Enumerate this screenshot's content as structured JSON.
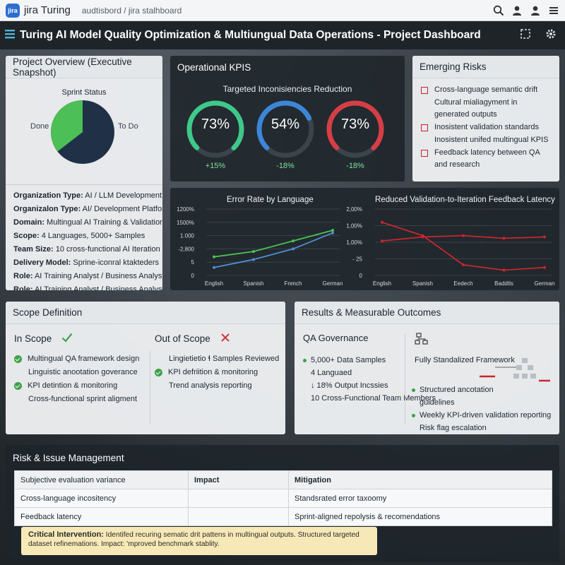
{
  "jira": {
    "logo_text": "jira",
    "app_name": "jira  Turing",
    "breadcrumb": "audtisbord / jira stalhboard"
  },
  "header": {
    "title": "Turing AI Model Quality Optimization & Multiungual Data Operations - Project Dashboard"
  },
  "overview": {
    "heading": "Project Overview (Executive Snapshot)",
    "sprint_status": "Sprint Status",
    "pie": {
      "done_label": "Done",
      "todo_label": "To Do",
      "done_color": "#4cbf56",
      "todo_color": "#1f3047"
    },
    "rows": [
      {
        "key": "Organization Type:",
        "value": " AI / LLM Development"
      },
      {
        "key": "Organizalon Type:",
        "value": " AI/ Development Platform"
      },
      {
        "key": "Domain:",
        "value": " Multingual AI Training & Validation"
      },
      {
        "key": "Scope:",
        "value": " 4 Languages, 5000+ Samples"
      },
      {
        "key": "Team Size:",
        "value": " 10 cross-functional AI Iteration"
      },
      {
        "key": "Delivery Model:",
        "value": " Sprine-iconral ktakteders"
      },
      {
        "key": "Role:",
        "value": " AI Training Analyst / Business Analyst"
      },
      {
        "key": "Role:",
        "value": " AI Training Analyst / Business Analyst"
      }
    ]
  },
  "kpi": {
    "heading": "Operational KPIS",
    "subtitle": "Targeted Inconisiencies Reduction",
    "gauges": [
      {
        "value": "73%",
        "delta": "+15%",
        "fraction": 0.73,
        "color": "#3ec98a"
      },
      {
        "value": "54%",
        "delta": "-18%",
        "fraction": 0.54,
        "color": "#3c86d8"
      },
      {
        "value": "73%",
        "delta": "-18%",
        "fraction": 0.73,
        "color": "#d63e45"
      }
    ]
  },
  "risks": {
    "heading": "Emerging Risks",
    "items": [
      {
        "text": "Cross-language semantic drift",
        "box": true
      },
      {
        "text": "Cultural mialiagyment in generated outputs",
        "box": false
      },
      {
        "text": "Inosistent validation standards",
        "box": true
      },
      {
        "text": "Inosistent unifed multingual KPIS",
        "box": false
      },
      {
        "text": "Feedback latency between QA and research",
        "box": true
      }
    ]
  },
  "chart_data": [
    {
      "type": "line",
      "title": "Error Rate by Language",
      "categories": [
        "English",
        "Spanish",
        "French",
        "German"
      ],
      "y_ticks": [
        "1200%",
        "1500%",
        "1.000",
        "-2,800",
        "5",
        "0"
      ],
      "series": [
        {
          "values": [
            0.7,
            0.9,
            1.3,
            1.7
          ],
          "color": "#4cc352"
        },
        {
          "values": [
            0.3,
            0.6,
            1.0,
            1.6
          ],
          "color": "#4f8fd1"
        }
      ],
      "ylim": [
        0,
        2.5
      ]
    },
    {
      "type": "line",
      "title": "Reduced Validation-to-Iteration Feedback Latency",
      "categories": [
        "English",
        "Spanish",
        "Eedech",
        "Baddtls",
        "German"
      ],
      "y_ticks": [
        "2,00%",
        "1,00%",
        "1,00%",
        "- 25",
        "0"
      ],
      "series": [
        {
          "values": [
            2.0,
            1.5,
            0.4,
            0.2,
            0.3
          ],
          "color": "#c8272e"
        },
        {
          "values": [
            1.3,
            1.45,
            1.5,
            1.4,
            1.45
          ],
          "color": "#c8272e"
        }
      ],
      "ylim": [
        0,
        2.5
      ]
    }
  ],
  "scope": {
    "heading": "Scope Definition",
    "in_title": "In Scope",
    "out_title": "Out of Scope",
    "in_items": [
      {
        "text": "Multingual QA framework design",
        "check": true
      },
      {
        "text": "Linguistic anootation goverance",
        "check": false
      },
      {
        "text": "KPI detintion & monitoring",
        "check": true
      },
      {
        "text": "Cross-functional sprint aligment",
        "check": false
      }
    ],
    "out_items": [
      {
        "text": "Lingietietio ɬ Samples Reviewed",
        "check": false
      },
      {
        "text": "KPI defriition & monitoring",
        "check": true
      },
      {
        "text": "Trend analysis reporting",
        "check": false
      }
    ]
  },
  "results": {
    "heading": "Results & Measurable Outcomes",
    "qa_title": "QA Governance",
    "left_items": [
      {
        "text": "5,000+ Data Samples",
        "dot": true
      },
      {
        "text": "4 Languaed",
        "dot": false
      },
      {
        "text": "↓ 18% Output Incssies",
        "dot": false
      },
      {
        "text": "10 Cross-Functional Team Members",
        "dot": false
      }
    ],
    "framework": "Fully Standalized Framework",
    "right_items": [
      {
        "text": "Structured ancotation",
        "dot": true
      },
      {
        "text": "guidelines",
        "dot": false
      },
      {
        "text": "Weekly KPI-driven validation reporting",
        "dot": true
      },
      {
        "text": "Risk flag escalation",
        "dot": false
      }
    ]
  },
  "issues": {
    "heading": "Risk & Issue Management",
    "columns": [
      "Subjective evaluation variance",
      "Impact",
      "Mitigation"
    ],
    "rows": [
      [
        "Cross-language incositency",
        "",
        "Standsrated error taxoomy"
      ],
      [
        "Feedback latency",
        "",
        "Sprint-aligned repolysis & recomendations"
      ]
    ],
    "callout_label": "Critical Intervention:",
    "callout_text": " Identifed recuring sematic drit pattens in multingual outputs. Structured targeted dataset refinemations. Impact: 'mproved benchmark stablity."
  }
}
